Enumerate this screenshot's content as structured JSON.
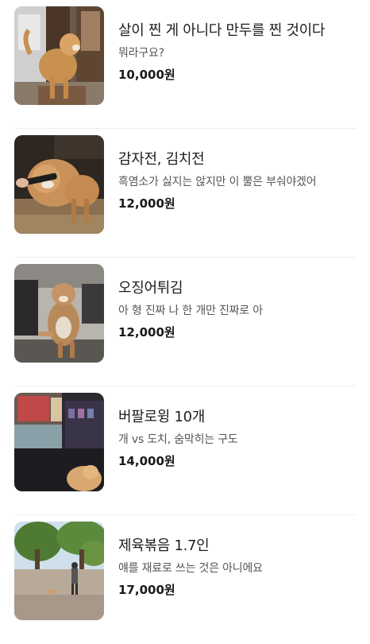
{
  "items": [
    {
      "title": "살이 찐 게 아니다 만두를 찐 것이다",
      "desc": "뭐라구요?",
      "price": "10,000원"
    },
    {
      "title": "감자전, 김치전",
      "desc": "흑염소가 싫지는 않지만 이 뿔은 부숴야겠어",
      "price": "12,000원"
    },
    {
      "title": "오징어튀김",
      "desc": "아 형 진짜 나 한 개만 진짜로 아",
      "price": "12,000원"
    },
    {
      "title": "버팔로윙 10개",
      "desc": "개 vs 도치, 숨막히는 구도",
      "price": "14,000원"
    },
    {
      "title": "제육볶음 1.7인",
      "desc": "얘를 재료로 쓰는 것은 아니에요",
      "price": "17,000원"
    }
  ]
}
